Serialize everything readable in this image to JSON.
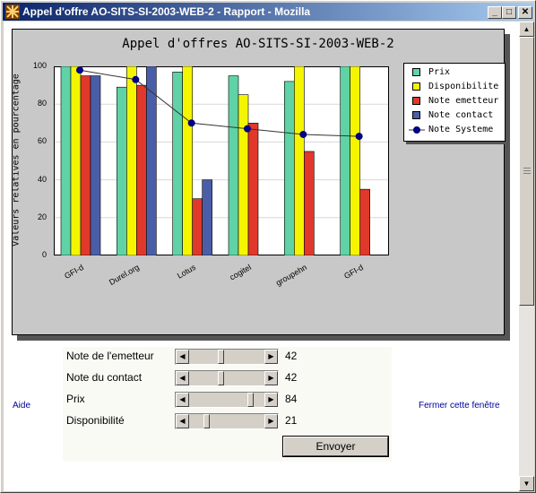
{
  "window": {
    "title": "Appel d'offre AO-SITS-SI-2003-WEB-2 - Rapport - Mozilla",
    "minimize_glyph": "_",
    "maximize_glyph": "□",
    "close_glyph": "✕"
  },
  "scrollbar": {
    "up_glyph": "▲",
    "down_glyph": "▼"
  },
  "chart_data": {
    "type": "bar",
    "title": "Appel d'offres AO-SITS-SI-2003-WEB-2",
    "ylabel": "Valeurs relatives en pourcentage",
    "xlabel": "",
    "ylim": [
      0,
      100
    ],
    "yticks": [
      "0",
      "20",
      "40",
      "60",
      "80",
      "100"
    ],
    "grid": true,
    "legend_position": "top-right",
    "categories": [
      "GFI-d",
      "Durel.org",
      "Lotus",
      "cogitel",
      "groupehn",
      "GFI-d"
    ],
    "series": [
      {
        "name": "Prix",
        "kind": "bar",
        "color": "#5fd3a6",
        "values": [
          100,
          89,
          97,
          95,
          92,
          100
        ]
      },
      {
        "name": "Disponibilite",
        "kind": "bar",
        "color": "#f5f500",
        "values": [
          100,
          100,
          100,
          85,
          100,
          100
        ]
      },
      {
        "name": "Note emetteur",
        "kind": "bar",
        "color": "#e0382a",
        "values": [
          95,
          90,
          30,
          70,
          55,
          35
        ]
      },
      {
        "name": "Note contact",
        "kind": "bar",
        "color": "#4a5ea8",
        "values": [
          95,
          100,
          40,
          null,
          null,
          null
        ]
      },
      {
        "name": "Note Systeme",
        "kind": "line",
        "color": "#00008b",
        "values": [
          98,
          93,
          70,
          67,
          64,
          63
        ]
      }
    ]
  },
  "controls": {
    "rows": [
      {
        "label": "Note de l'emetteur",
        "value": "42",
        "fraction": 0.42
      },
      {
        "label": "Note du contact",
        "value": "42",
        "fraction": 0.42
      },
      {
        "label": "Prix",
        "value": "84",
        "fraction": 0.84
      },
      {
        "label": "Disponibilité",
        "value": "21",
        "fraction": 0.21
      }
    ],
    "arrow_left": "◀",
    "arrow_right": "▶",
    "submit_label": "Envoyer"
  },
  "links": {
    "help": "Aide",
    "close": "Fermer cette fenêtre"
  }
}
